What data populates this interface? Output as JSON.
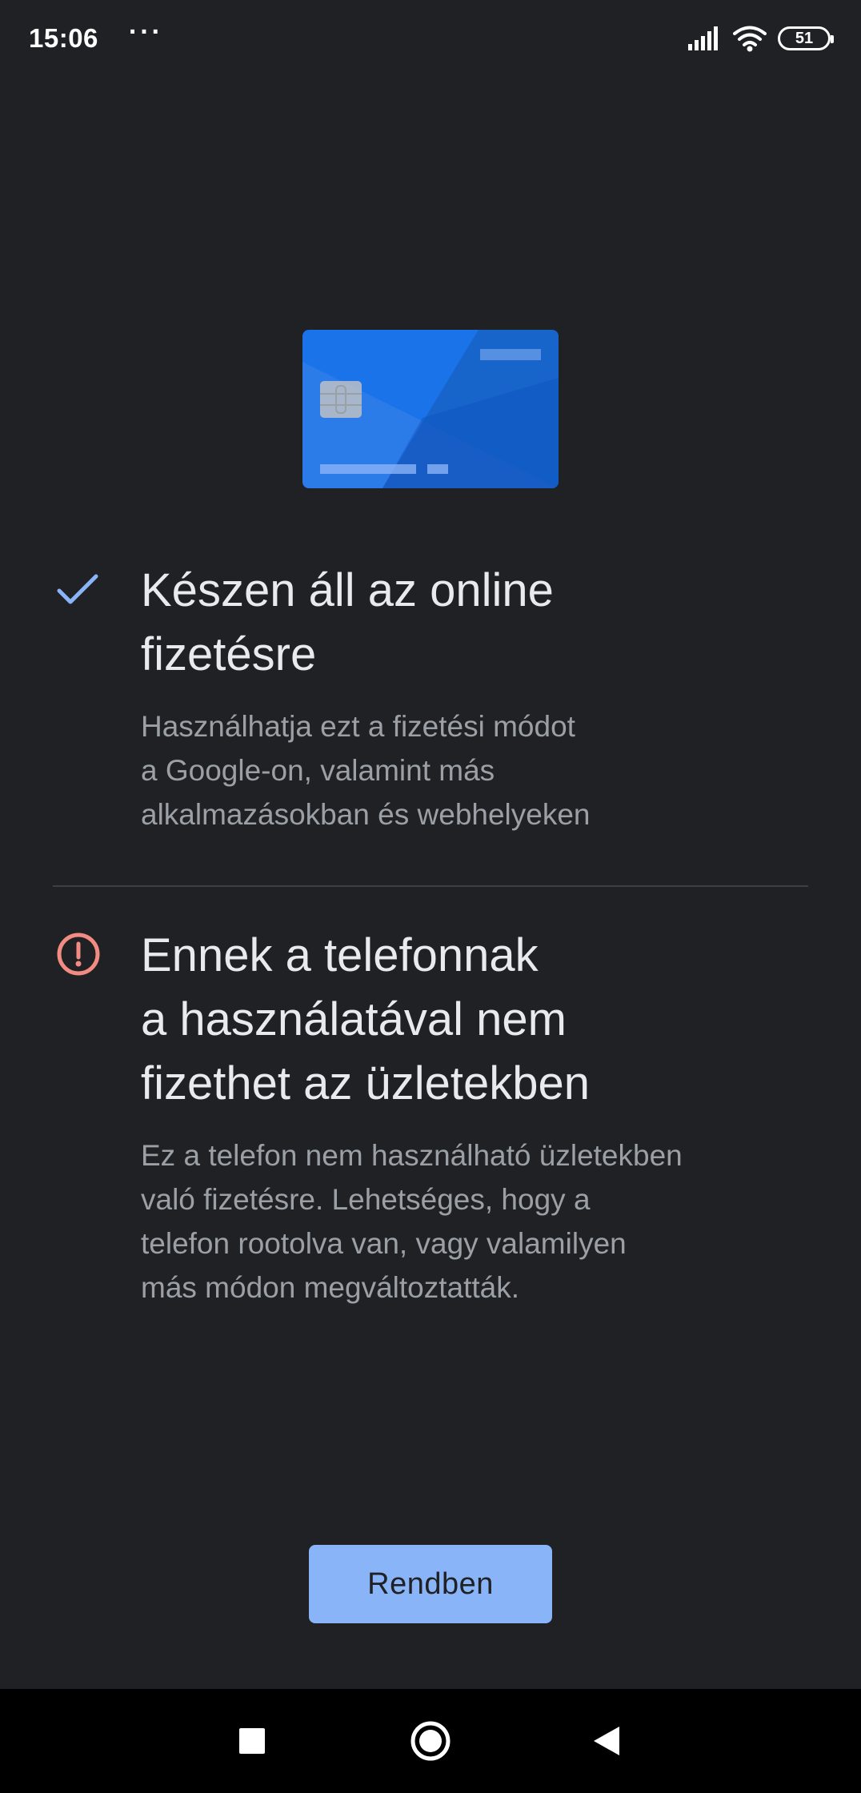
{
  "status_bar": {
    "time": "15:06",
    "more_indicator": "···",
    "battery": "51",
    "icons": [
      "signal-icon",
      "wifi-icon",
      "battery-icon"
    ]
  },
  "illustration": {
    "icon": "credit-card-icon",
    "color": "#1a73e8"
  },
  "online_section": {
    "icon": "checkmark-icon",
    "icon_color": "#8ab4f8",
    "title_lines": [
      "Készen áll az online",
      "fizetésre"
    ],
    "description_lines": [
      "Használhatja ezt a fizetési módot",
      "a Google-on, valamint más",
      "alkalmazásokban és webhelyeken"
    ]
  },
  "store_section": {
    "icon": "error-alert-icon",
    "icon_color": "#f28b82",
    "title_lines": [
      "Ennek a telefonnak",
      "a használatával nem",
      "fizethet az üzletekben"
    ],
    "description_lines": [
      "Ez a telefon nem használható üzletekben",
      "való fizetésre. Lehetséges, hogy a",
      "telefon rootolva van, vagy valamilyen",
      "más módon megváltoztatták."
    ]
  },
  "ok_button": {
    "label": "Rendben",
    "color": "#8ab4f8"
  },
  "nav_bar": {
    "icons": [
      "recents-square-icon",
      "home-circle-icon",
      "back-triangle-icon"
    ]
  }
}
